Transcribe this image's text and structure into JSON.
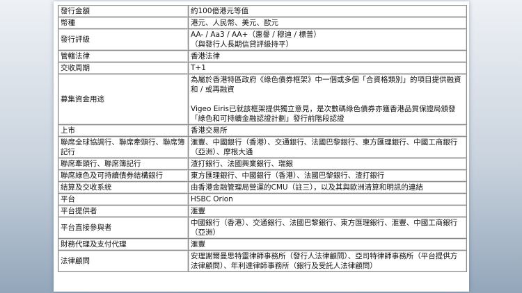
{
  "rows": [
    {
      "label": "發行金額",
      "value": [
        "約100億港元等值"
      ]
    },
    {
      "label": "幣種",
      "value": [
        "港元、人民幣、美元、歐元"
      ]
    },
    {
      "label": "發行評級",
      "value": [
        "AA- / Aa3 / AA+（惠譽 / 穆迪 / 標普）",
        "（與發行人長期信貸評級持平）"
      ]
    },
    {
      "label": "管轄法律",
      "value": [
        "香港法律"
      ]
    },
    {
      "label": "交收周期",
      "value": [
        "T+1"
      ]
    },
    {
      "label": "募集資金用途",
      "value": [
        "為屬於香港特區政府《綠色債券框架》中一個或多個「合資格類別」的項目提供融資和 / 或再融資",
        "",
        "Vigeo Eiris已就該框架提供獨立意見，是次數碼綠色債券亦獲香港品質保證局頒發「綠色和可持續金融認證計劃」發行前階段認證"
      ]
    },
    {
      "label": "上市",
      "value": [
        "香港交易所"
      ]
    },
    {
      "label": "聯席全球協調行、聯席牽頭行、聯席簿記行",
      "value": [
        "滙豐、中國銀行（香港）、交通銀行、法國巴黎銀行、東方匯理銀行、中國工商銀行（亞洲）、摩根大通"
      ]
    },
    {
      "label": "聯席牽頭行、聯席簿記行",
      "value": [
        "渣打銀行、法國興業銀行、瑞銀"
      ]
    },
    {
      "label": "聯席綠色及可持續債券結構銀行",
      "value": [
        "東方匯理銀行、中國銀行（香港）、法國巴黎銀行、渣打銀行"
      ]
    },
    {
      "label": "結算及交收系統",
      "value": [
        "由香港金融管理局營運的CMU（註三），以及其與歐洲清算和明訊的連結"
      ]
    },
    {
      "label": "平台",
      "value": [
        "HSBC Orion"
      ]
    },
    {
      "label": "平台提供者",
      "value": [
        "滙豐"
      ]
    },
    {
      "label": "平台直接參與者",
      "value": [
        "中國銀行（香港）、交通銀行、法國巴黎銀行、東方匯理銀行、滙豐、中國工商銀行（亞洲）"
      ]
    },
    {
      "label": "財務代理及支付代理",
      "value": [
        "滙豐"
      ]
    },
    {
      "label": "法律顧問",
      "value": [
        "安理謝爾曼思特靈律師事務所（發行人法律顧問）、亞司特律師事務所（平台提供方法律顧問）、年利達律師事務所（銀行及受託人法律顧問）"
      ]
    }
  ]
}
